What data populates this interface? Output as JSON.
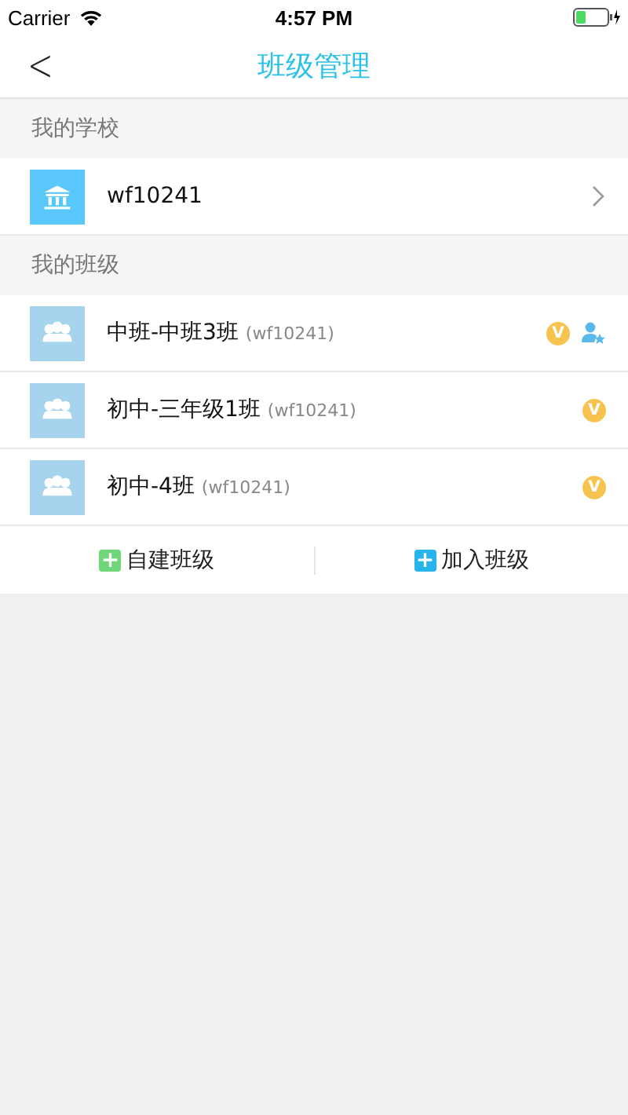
{
  "status_bar": {
    "carrier": "Carrier",
    "time": "4:57 PM"
  },
  "nav": {
    "back": "<",
    "title": "班级管理"
  },
  "school_section": {
    "header": "我的学校",
    "school": "wf10241"
  },
  "class_section": {
    "header": "我的班级",
    "classes": [
      {
        "name": "中班-中班3班",
        "code": "(wf10241)",
        "badge": "V",
        "admin": true
      },
      {
        "name": "初中-三年级1班",
        "code": "(wf10241)",
        "badge": "V",
        "admin": false
      },
      {
        "name": "初中-4班",
        "code": "(wf10241)",
        "badge": "V",
        "admin": false
      }
    ]
  },
  "actions": [
    {
      "label": "自建班级",
      "icon": "+",
      "color": "#6fd67a"
    },
    {
      "label": "加入班级",
      "icon": "+",
      "color": "#27b4ec"
    }
  ]
}
